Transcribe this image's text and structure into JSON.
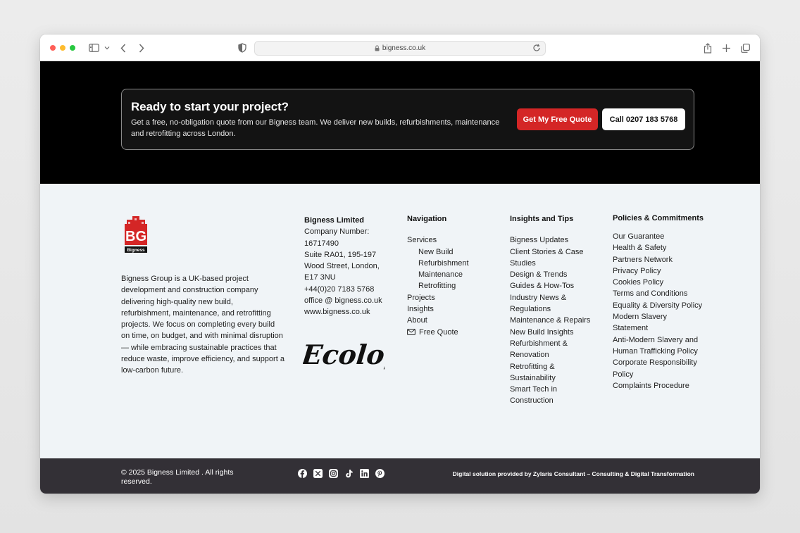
{
  "browser": {
    "url": "bigness.co.uk",
    "icons": [
      "sidebar-icon",
      "chevron-down-icon",
      "back-icon",
      "forward-icon",
      "shield-icon",
      "lock-icon",
      "reload-icon",
      "share-icon",
      "new-tab-icon",
      "tabs-overview-icon"
    ]
  },
  "cta": {
    "title": "Ready to start your project?",
    "text": "Get a free, no-obligation quote from our Bigness team. We deliver new builds, refurbishments, maintenance and retrofitting across London.",
    "quote_button": "Get My Free Quote",
    "call_button": "Call 0207 183 5768",
    "colors": {
      "band": "#000000",
      "quote_button": "#d42626"
    }
  },
  "brand": {
    "logo_letters": "BG",
    "logo_word": "Bigness",
    "logo_color": "#d42626",
    "about": "Bigness Group is a UK-based project development and construction company delivering high-quality new build, refurbishment, maintenance, and retrofitting projects. We focus on completing every build on time, on budget, and with minimal disruption — while embracing sustainable practices that reduce waste, improve efficiency, and support a low-carbon future."
  },
  "company": {
    "name": "Bigness Limited",
    "number_label": "Company Number:",
    "number": "16717490",
    "address_1": "Suite RA01, 195-197",
    "address_2": "Wood Street, London,",
    "postcode": "E17 3NU",
    "phone": "+44(0)20 7183 5768",
    "email": "office @ bigness.co.uk",
    "website": "www.bigness.co.uk",
    "partner_logo": "Ecologi"
  },
  "navigation": {
    "heading": "Navigation",
    "services": "Services",
    "sub_items": [
      "New Build",
      "Refurbishment",
      "Maintenance",
      "Retrofitting"
    ],
    "items": [
      "Projects",
      "Insights",
      "About"
    ],
    "free_quote": "Free Quote"
  },
  "insights": {
    "heading": "Insights and Tips",
    "items": [
      "Bigness Updates",
      "Client Stories & Case Studies",
      "Design & Trends",
      "Guides & How-Tos",
      "Industry News & Regulations",
      "Maintenance & Repairs",
      "New Build Insights",
      "Refurbishment & Renovation",
      "Retrofitting & Sustainability",
      "Smart Tech in Construction"
    ]
  },
  "policies": {
    "heading": "Policies & Commitments",
    "items": [
      "Our Guarantee",
      "Health & Safety",
      "Partners Network",
      "Privacy Policy",
      "Cookies Policy",
      "Terms and Conditions",
      "Equality & Diversity Policy",
      "Modern Slavery Statement",
      "Anti-Modern Slavery and Human Trafficking Policy",
      "Corporate Responsibility Policy",
      "Complaints Procedure"
    ]
  },
  "footer": {
    "copyright": "© 2025 Bigness Limited . All rights reserved.",
    "credit": "Digital solution provided by Zylaris Consultant – Consulting & Digital Transformation",
    "socials": [
      "facebook-icon",
      "x-icon",
      "instagram-icon",
      "tiktok-icon",
      "linkedin-icon",
      "pinterest-icon"
    ]
  }
}
